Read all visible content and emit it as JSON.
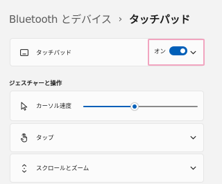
{
  "breadcrumb": {
    "parent": "Bluetooth とデバイス",
    "separator": "›",
    "current": "タッチパッド"
  },
  "touchpad_card": {
    "label": "タッチパッド",
    "icon": "touchpad-icon",
    "toggle_label": "オン",
    "toggle_on": true,
    "expand_icon": "chevron-down-icon"
  },
  "section": {
    "heading": "ジェスチャーと操作"
  },
  "cursor_speed": {
    "label": "カーソル速度",
    "icon": "cursor-icon",
    "value_fraction": 0.45
  },
  "tap": {
    "label": "タップ",
    "icon": "tap-hand-icon"
  },
  "scroll_zoom": {
    "label": "スクロールとズーム",
    "icon": "scroll-arrows-icon"
  },
  "colors": {
    "accent": "#005fb8",
    "highlight": "#f2a5c0"
  }
}
